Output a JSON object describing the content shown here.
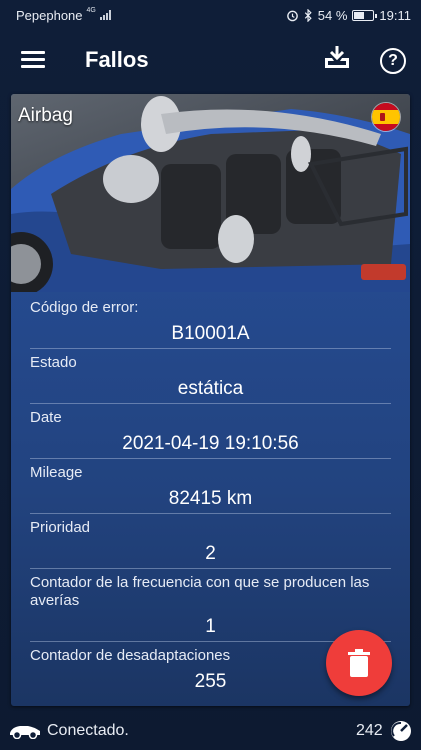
{
  "status_bar": {
    "carrier": "Pepephone",
    "network_type": "4G",
    "battery_percent": "54 %",
    "battery_level": 0.54,
    "time": "19:11"
  },
  "app_bar": {
    "title": "Fallos",
    "icons": [
      "menu-icon",
      "download-inbox-icon",
      "help-icon"
    ]
  },
  "card": {
    "title": "Airbag",
    "flag": "spain-flag",
    "fields": [
      {
        "label": "Código de error:",
        "value": "B10001A"
      },
      {
        "label": "Estado",
        "value": "estática"
      },
      {
        "label": "Date",
        "value": "2021-04-19 19:10:56"
      },
      {
        "label": "Mileage",
        "value": "82415 km"
      },
      {
        "label": "Prioridad",
        "value": "2"
      },
      {
        "label": "Contador de la frecuencia con que se producen las averías",
        "value": "1"
      },
      {
        "label": "Contador de desadaptaciones",
        "value": "255"
      }
    ]
  },
  "fab": {
    "icon": "trash-icon",
    "color": "#ef3d3a"
  },
  "bottom_bar": {
    "connection_icon": "car-connection-icon",
    "connection_text": "Conectado.",
    "counter": "242",
    "gauge_icon": "gauge-icon"
  }
}
